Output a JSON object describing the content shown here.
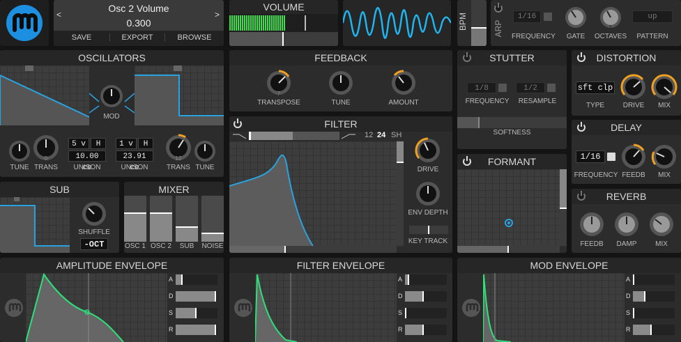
{
  "preset": {
    "name": "Osc 2 Volume",
    "value": "0.300",
    "prev": "<",
    "next": ">",
    "save": "SAVE",
    "export": "EXPORT",
    "browse": "BROWSE"
  },
  "volume": {
    "title": "VOLUME"
  },
  "bpm": {
    "label": "BPM"
  },
  "arp": {
    "label": "ARP",
    "frequency_value": "1/16",
    "frequency": "FREQUENCY",
    "gate": "GATE",
    "octaves": "OCTAVES",
    "octaves_value": "1",
    "pattern": "PATTERN",
    "pattern_value": "up"
  },
  "oscillators": {
    "title": "OSCILLATORS",
    "mod": "MOD",
    "tune": "TUNE",
    "trans": "TRANS",
    "trans1_value": "0",
    "trans2_value": "12",
    "unison": "UNISON",
    "osc1_voices": "5 v",
    "osc1_h": "H",
    "osc1_detune": "10.00 ce",
    "osc2_voices": "1 v",
    "osc2_h": "H",
    "osc2_detune": "23.91 ce"
  },
  "feedback": {
    "title": "FEEDBACK",
    "transpose": "TRANSPOSE",
    "transpose_value": "7",
    "tune": "TUNE",
    "amount": "AMOUNT"
  },
  "stutter": {
    "title": "STUTTER",
    "frequency_value": "1/8",
    "resample_value": "1/2",
    "frequency": "FREQUENCY",
    "resample": "RESAMPLE",
    "softness": "SOFTNESS"
  },
  "distortion": {
    "title": "DISTORTION",
    "type_value": "sft clp",
    "type": "TYPE",
    "drive": "DRIVE",
    "mix": "MIX"
  },
  "delay": {
    "title": "DELAY",
    "frequency_value": "1/16",
    "frequency": "FREQUENCY",
    "feedb": "FEEDB",
    "mix": "MIX"
  },
  "reverb": {
    "title": "REVERB",
    "feedb": "FEEDB",
    "damp": "DAMP",
    "mix": "MIX"
  },
  "filter": {
    "title": "FILTER",
    "slope12": "12",
    "slope24": "24",
    "slope_sh": "SH",
    "drive": "DRIVE",
    "env_depth": "ENV DEPTH",
    "key_track": "KEY TRACK"
  },
  "formant": {
    "title": "FORMANT"
  },
  "sub": {
    "title": "SUB",
    "shuffle": "SHUFFLE",
    "octave_value": "-OCT"
  },
  "mixer": {
    "title": "MIXER",
    "osc1": "OSC 1",
    "osc2": "OSC 2",
    "sub": "SUB",
    "noise": "NOISE",
    "levels": [
      0.63,
      0.63,
      0.33,
      0.2
    ]
  },
  "envelopes": [
    {
      "title": "AMPLITUDE ENVELOPE",
      "a": "A",
      "d": "D",
      "s": "S",
      "r": "R",
      "levels": [
        0.17,
        0.97,
        0.5,
        0.97
      ]
    },
    {
      "title": "FILTER ENVELOPE",
      "a": "A",
      "d": "D",
      "s": "S",
      "r": "R",
      "levels": [
        0.1,
        0.45,
        0.0,
        0.45
      ]
    },
    {
      "title": "MOD ENVELOPE",
      "a": "A",
      "d": "D",
      "s": "S",
      "r": "R",
      "levels": [
        0.0,
        0.3,
        0.0,
        0.45
      ]
    }
  ],
  "colors": {
    "accent": "#f0a020",
    "blue": "#29a3e0",
    "green": "#2ee07a",
    "panel": "#2c2c2c"
  }
}
